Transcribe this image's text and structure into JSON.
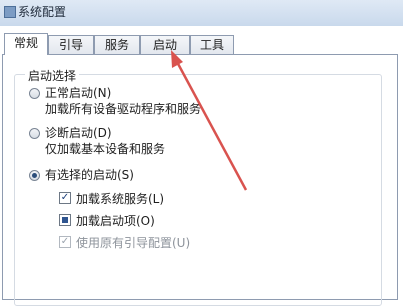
{
  "window": {
    "title": "系统配置"
  },
  "tabs": [
    {
      "label": "常规"
    },
    {
      "label": "引导"
    },
    {
      "label": "服务"
    },
    {
      "label": "启动"
    },
    {
      "label": "工具"
    }
  ],
  "startup_group": {
    "title": "启动选择",
    "normal": {
      "label": "正常启动(N)",
      "desc": "加载所有设备驱动程序和服务",
      "selected": false
    },
    "diagnostic": {
      "label": "诊断启动(D)",
      "desc": "仅加载基本设备和服务",
      "selected": false
    },
    "selective": {
      "label": "有选择的启动(S)",
      "selected": true,
      "options": [
        {
          "label": "加载系统服务(L)",
          "state": "checked"
        },
        {
          "label": "加载启动项(O)",
          "state": "indeterminate"
        },
        {
          "label": "使用原有引导配置(U)",
          "state": "checked-disabled"
        }
      ]
    }
  },
  "annotation": {
    "arrow_color": "#d9534f"
  }
}
